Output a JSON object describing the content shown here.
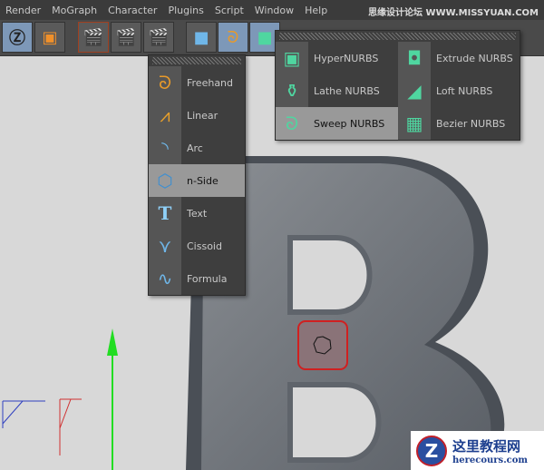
{
  "menubar": {
    "items": [
      "Render",
      "MoGraph",
      "Character",
      "Plugins",
      "Script",
      "Window",
      "Help"
    ],
    "watermark": "思缘设计论坛 WWW.MISSYUAN.COM"
  },
  "spline_menu": {
    "items": [
      {
        "label": "Freehand",
        "icon": "freehand-icon"
      },
      {
        "label": "Linear",
        "icon": "linear-icon"
      },
      {
        "label": "Arc",
        "icon": "arc-icon"
      },
      {
        "label": "n-Side",
        "icon": "nside-icon",
        "highlighted": true
      },
      {
        "label": "Text",
        "icon": "text-icon"
      },
      {
        "label": "Cissoid",
        "icon": "cissoid-icon"
      },
      {
        "label": "Formula",
        "icon": "formula-icon"
      }
    ]
  },
  "nurbs_menu": {
    "items": [
      {
        "label": "HyperNURBS"
      },
      {
        "label": "Extrude NURBS"
      },
      {
        "label": "Lathe NURBS"
      },
      {
        "label": "Loft NURBS"
      },
      {
        "label": "Sweep NURBS",
        "highlighted": true
      },
      {
        "label": "Bezier NURBS"
      }
    ]
  },
  "logo": {
    "title": "这里教程网",
    "url": "herecours.com"
  },
  "colors": {
    "accent": "#7d98b8",
    "nurbs_green": "#4fd6a0",
    "selection": "#d02020"
  }
}
